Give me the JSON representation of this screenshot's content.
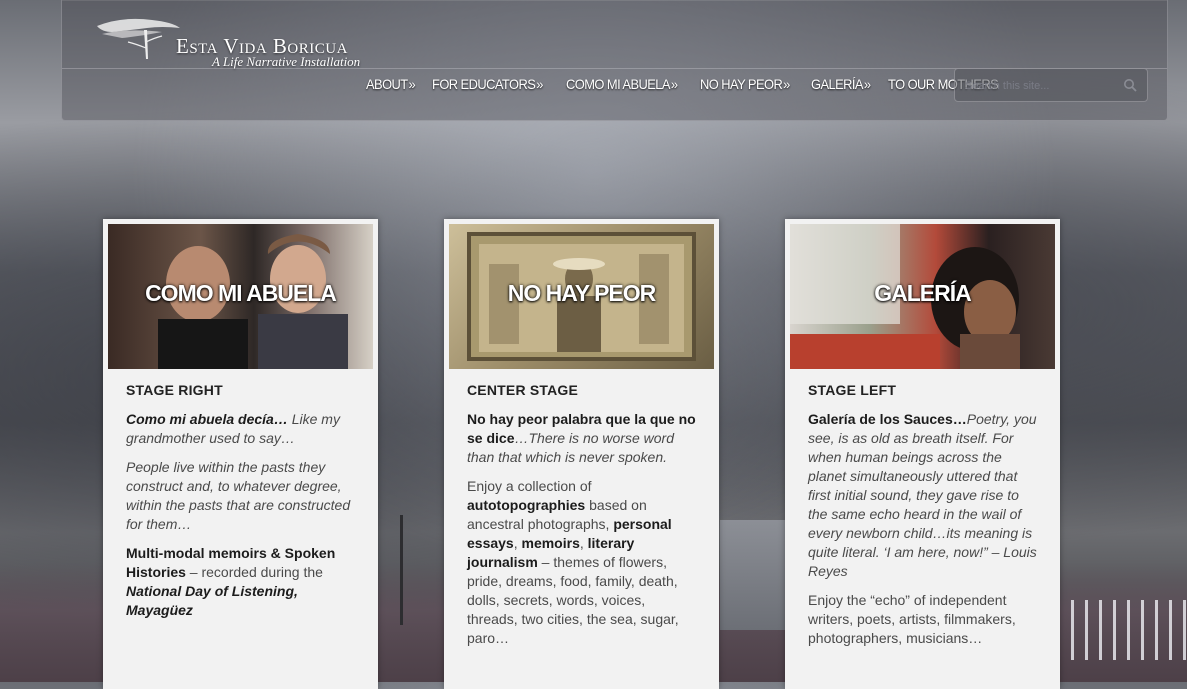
{
  "site": {
    "title": "Esta Vida Boricua",
    "subtitle": "A Life Narrative Installation"
  },
  "nav": [
    {
      "label": "ABOUT",
      "arrow": "»"
    },
    {
      "label": "FOR EDUCATORS",
      "arrow": "»"
    },
    {
      "label": "COMO MI ABUELA",
      "arrow": "»"
    },
    {
      "label": "NO HAY PEOR",
      "arrow": "»"
    },
    {
      "label": "GALERÍA",
      "arrow": "»"
    },
    {
      "label": "TO OUR MOTHERS",
      "arrow": ""
    }
  ],
  "search": {
    "placeholder": "Search this site..."
  },
  "cards": [
    {
      "photo_title": "COMO MI ABUELA",
      "stage": "STAGE RIGHT",
      "p1_bold": "Como mi abuela decía…",
      "p1_rest": " Like my grandmother used to say…",
      "p2": "People live within the pasts they construct and, to whatever degree, within the pasts that are constructed for them…",
      "p3_bold": "Multi-modal memoirs  &  Spoken Histories",
      "p3_rest": " – recorded during the ",
      "p3_bi": "National Day of Listening, Mayagüez"
    },
    {
      "photo_title": "NO HAY PEOR",
      "stage": "CENTER STAGE",
      "p1_bold": "No hay peor palabra que la que no se dice",
      "p1_rest": "…There is no worse word than that which is never spoken.",
      "p2_a": "Enjoy a collection of ",
      "p2_b": "autotopographies",
      "p2_c": " based on ancestral photographs, ",
      "p2_d": "personal essays",
      "p2_e": ", ",
      "p2_f": "memoirs",
      "p2_g": ", ",
      "p2_h": "literary journalism",
      "p2_i": "  – themes of flowers, pride, dreams, food, family, death, dolls, secrets, words, voices, threads, two cities, the sea, sugar, paro…"
    },
    {
      "photo_title": "GALERÍA",
      "stage": "STAGE LEFT",
      "p1_bold": "Galería de los Sauces…",
      "p1_rest": "Poetry, you see, is as old as breath itself. For when human beings across the planet simultaneously uttered that first initial sound, they gave rise to the same echo heard in the wail of every newborn child…its meaning is quite literal. ‘I am here, now!” – Louis Reyes",
      "p2": "Enjoy the “echo” of  independent writers, poets, artists, filmmakers, photographers, musicians…"
    }
  ],
  "colors": {
    "card_bg": "#f2f2f2",
    "text": "#4a4a4a",
    "heading": "#222222"
  }
}
